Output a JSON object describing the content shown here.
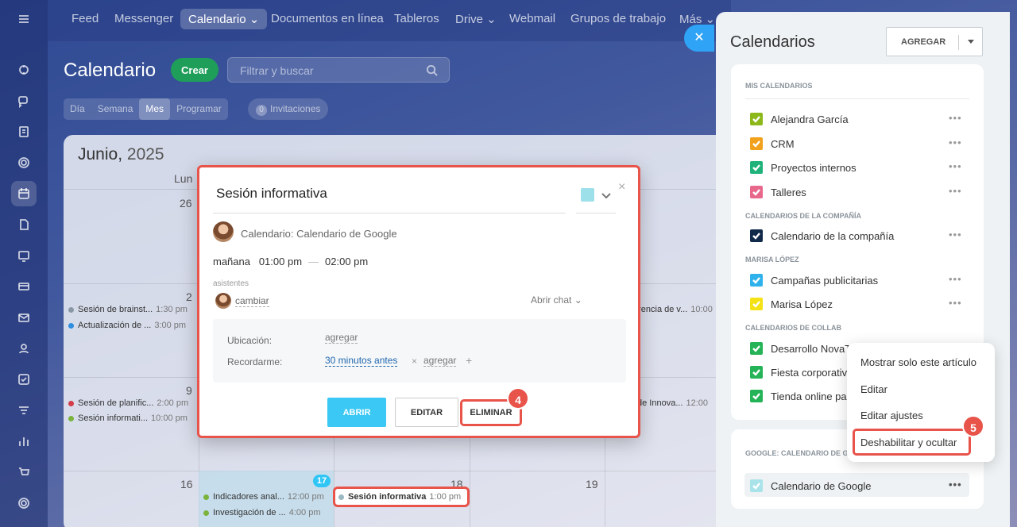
{
  "nav": {
    "items": [
      "Feed",
      "Messenger",
      "Calendario",
      "Documentos en línea",
      "Tableros",
      "Drive",
      "Webmail",
      "Grupos de trabajo",
      "Más"
    ],
    "active": "Calendario"
  },
  "calendar": {
    "title": "Calendario",
    "create_label": "Crear",
    "search_placeholder": "Filtrar y buscar",
    "views": [
      "Día",
      "Semana",
      "Mes",
      "Programar"
    ],
    "active_view": "Mes",
    "invitations_count": "0",
    "invitations_label": "Invitaciones",
    "month": "Junio,",
    "year": "2025",
    "weekday": "Lun",
    "days": [
      "26",
      "2",
      "9",
      "16",
      "17",
      "18",
      "19"
    ],
    "events": [
      {
        "title": "Sesión de brainst...",
        "time": "1:30 pm",
        "color": "#8a98a6"
      },
      {
        "title": "Actualización de ...",
        "time": "3:00 pm",
        "color": "#2f8ee0"
      },
      {
        "title": "Sesión de planific...",
        "time": "2:00 pm",
        "color": "#d43c48"
      },
      {
        "title": "Sesión informati...",
        "time": "10:00 pm",
        "color": "#7ab33d"
      },
      {
        "title": "Indicadores anal...",
        "time": "12:00 pm",
        "color": "#7ab33d"
      },
      {
        "title": "Investigación de ...",
        "time": "4:00 pm",
        "color": "#7ab33d"
      },
      {
        "title": "Sesión informativa",
        "time": "1:00 pm",
        "color": "#9ab7c2"
      },
      {
        "title": "erencia de v...",
        "time": "10:00",
        "color": ""
      },
      {
        "title": "de Innova...",
        "time": "12:00",
        "color": ""
      }
    ]
  },
  "popup": {
    "title": "Sesión informativa",
    "calendar_line": "Calendario: Calendario de Google",
    "day": "mañana",
    "start": "01:00 pm",
    "end": "02:00 pm",
    "attendees_label": "asistentes",
    "change_label": "cambiar",
    "open_chat": "Abrir chat",
    "location_label": "Ubicación:",
    "location_value": "agregar",
    "reminder_label": "Recordarme:",
    "reminder_value": "30 minutos antes",
    "reminder_add": "agregar",
    "btn_open": "ABRIR",
    "btn_edit": "EDITAR",
    "btn_delete": "ELIMINAR",
    "step_badge": "4",
    "color": "#9ee0ea"
  },
  "panel": {
    "title": "Calendarios",
    "add_label": "AGREGAR",
    "sections": {
      "mine": "MIS CALENDARIOS",
      "company": "CALENDARIOS DE LA COMPAÑÍA",
      "marisa": "MARISA LÓPEZ",
      "collab": "CALENDARIOS DE COLLAB",
      "google": "GOOGLE: CALENDARIO DE G"
    },
    "calendars": [
      {
        "name": "Alejandra García",
        "color": "#8cb81a"
      },
      {
        "name": "CRM",
        "color": "#f2a11c"
      },
      {
        "name": "Proyectos internos",
        "color": "#1fb27a"
      },
      {
        "name": "Talleres",
        "color": "#e8688c"
      },
      {
        "name": "Calendario de la compañía",
        "color": "#122a4a"
      },
      {
        "name": "Campañas publicitarias",
        "color": "#2fb2ec"
      },
      {
        "name": "Marisa López",
        "color": "#f5e214"
      },
      {
        "name": "Desarrollo NovaT",
        "color": "#24b357"
      },
      {
        "name": "Fiesta corporativ",
        "color": "#24b357"
      },
      {
        "name": "Tienda online pa",
        "color": "#24b357"
      },
      {
        "name": "Calendario de Google",
        "color": "#a9e3ea"
      }
    ]
  },
  "context_menu": {
    "items": [
      "Mostrar solo este artículo",
      "Editar",
      "Editar ajustes",
      "Deshabilitar y ocultar"
    ],
    "step_badge": "5"
  }
}
